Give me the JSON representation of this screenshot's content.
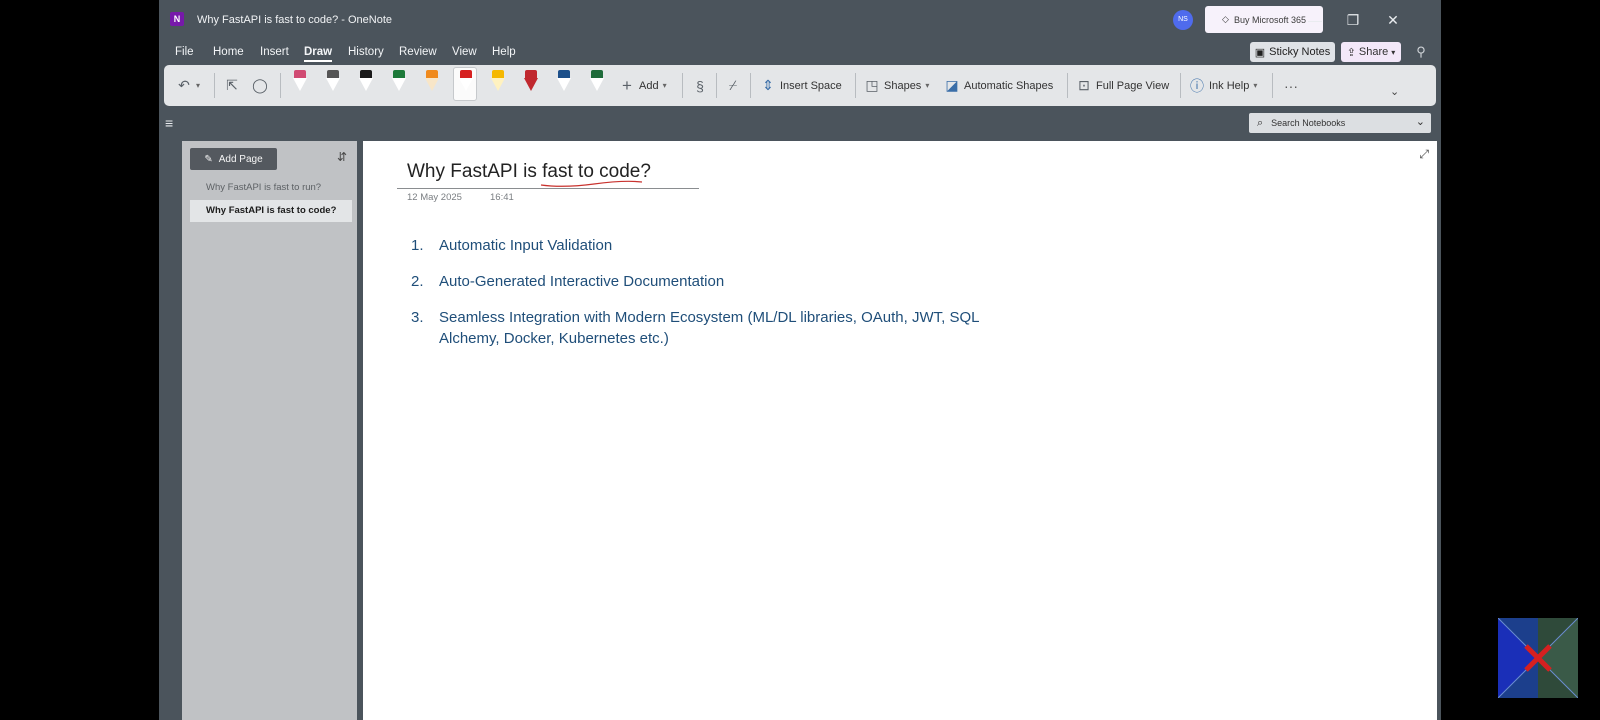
{
  "window": {
    "title": "Why FastAPI is fast to code?  -  OneNote",
    "app_icon_letter": "N",
    "avatar_initials": "NS",
    "buy_label": "Buy Microsoft 365"
  },
  "menu": {
    "items": [
      "File",
      "Home",
      "Insert",
      "Draw",
      "History",
      "Review",
      "View",
      "Help"
    ],
    "active": "Draw",
    "sticky_notes": "Sticky Notes",
    "share": "Share"
  },
  "ribbon": {
    "add_label": "Add",
    "insert_space": "Insert Space",
    "shapes": "Shapes",
    "automatic_shapes": "Automatic Shapes",
    "full_page_view": "Full Page View",
    "ink_help": "Ink Help",
    "more": "···",
    "pen_colors": [
      "#d14b73",
      "#ffffff",
      "#1a1a1a",
      "#1d7a3a",
      "#f08a1c",
      "#d62020",
      "#f5b800",
      "#c0282e",
      "#1c4f8a",
      "#1f6b3a"
    ]
  },
  "notebook": {
    "search_placeholder": "Search Notebooks"
  },
  "pages": {
    "add_page": "Add Page",
    "items": [
      "Why FastAPI is fast to run?",
      "Why FastAPI is fast to code?"
    ],
    "selected_index": 1
  },
  "page": {
    "title": "Why FastAPI is fast to code?",
    "date": "12 May 2025",
    "time": "16:41",
    "list": [
      {
        "num": "1.",
        "text": "Automatic Input Validation"
      },
      {
        "num": "2.",
        "text": "Auto-Generated Interactive Documentation"
      },
      {
        "num": "3.",
        "text": "Seamless Integration with Modern Ecosystem (ML/DL libraries, OAuth, JWT, SQL Alchemy, Docker, Kubernetes etc.)"
      }
    ]
  },
  "icons": [
    "undo-icon",
    "select-icon",
    "lasso-icon",
    "add-icon",
    "ink-to-shape-icon",
    "ruler-icon",
    "insert-space-icon",
    "shapes-icon",
    "auto-shapes-icon",
    "full-page-icon",
    "help-icon",
    "search-icon",
    "expand-icon",
    "sort-icon",
    "new-page-icon",
    "hamburger-icon",
    "sticky-note-icon",
    "share-icon",
    "feedback-icon",
    "diamond-icon"
  ],
  "colors": {
    "chrome": "#4b545c",
    "ribbon": "#e4e6e8",
    "page_list": "#c0c2c5",
    "list_text": "#1f4e79",
    "ink_underline": "#c8322e"
  }
}
